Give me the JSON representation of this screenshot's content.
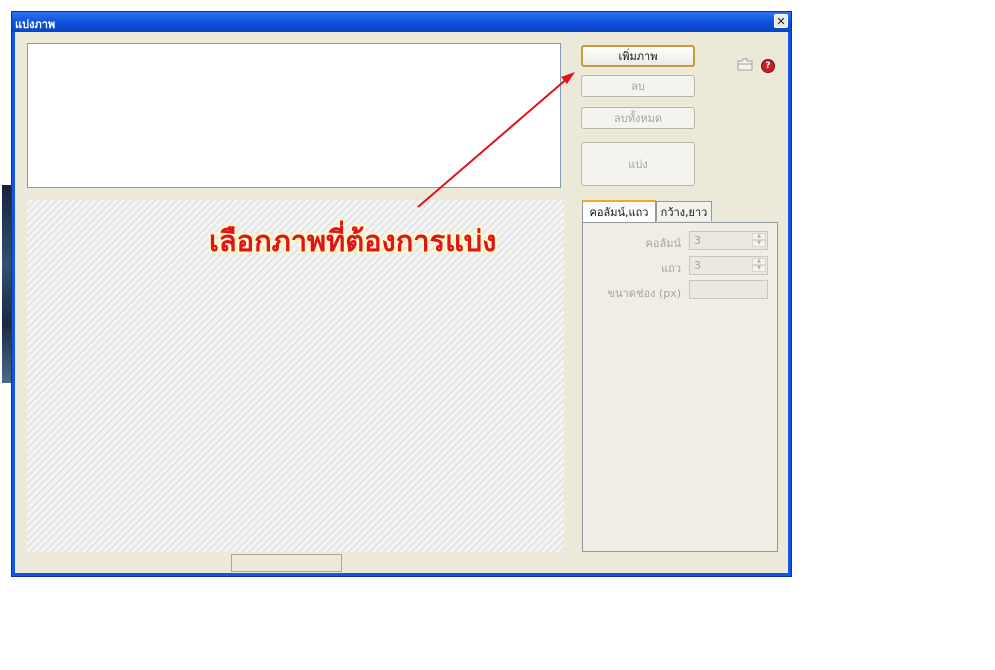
{
  "window": {
    "title": "แบ่งภาพ",
    "close_glyph": "✕"
  },
  "buttons": {
    "add": "เพิ่มภาพ",
    "delete": "ลบ",
    "delete_all": "ลบทั้งหมด",
    "split": "แบ่ง"
  },
  "icons": {
    "folder": "folder-icon",
    "help": "help-icon",
    "help_glyph": "?"
  },
  "tabs": [
    {
      "label": "คอลัมน์,แถว",
      "active": true
    },
    {
      "label": "กว้าง,ยาว",
      "active": false
    }
  ],
  "fields": {
    "columns": {
      "label": "คอลัมน์",
      "value": "3"
    },
    "rows": {
      "label": "แถว",
      "value": "3"
    },
    "cell_size": {
      "label": "ขนาดช่อง (px)",
      "value": ""
    }
  },
  "annotation": {
    "text": "เลือกภาพที่ต้องการแบ่ง",
    "color": "#e0121a"
  },
  "colors": {
    "titlebar": "#0f52de",
    "face": "#ece9d8",
    "accent": "#f0a828"
  }
}
